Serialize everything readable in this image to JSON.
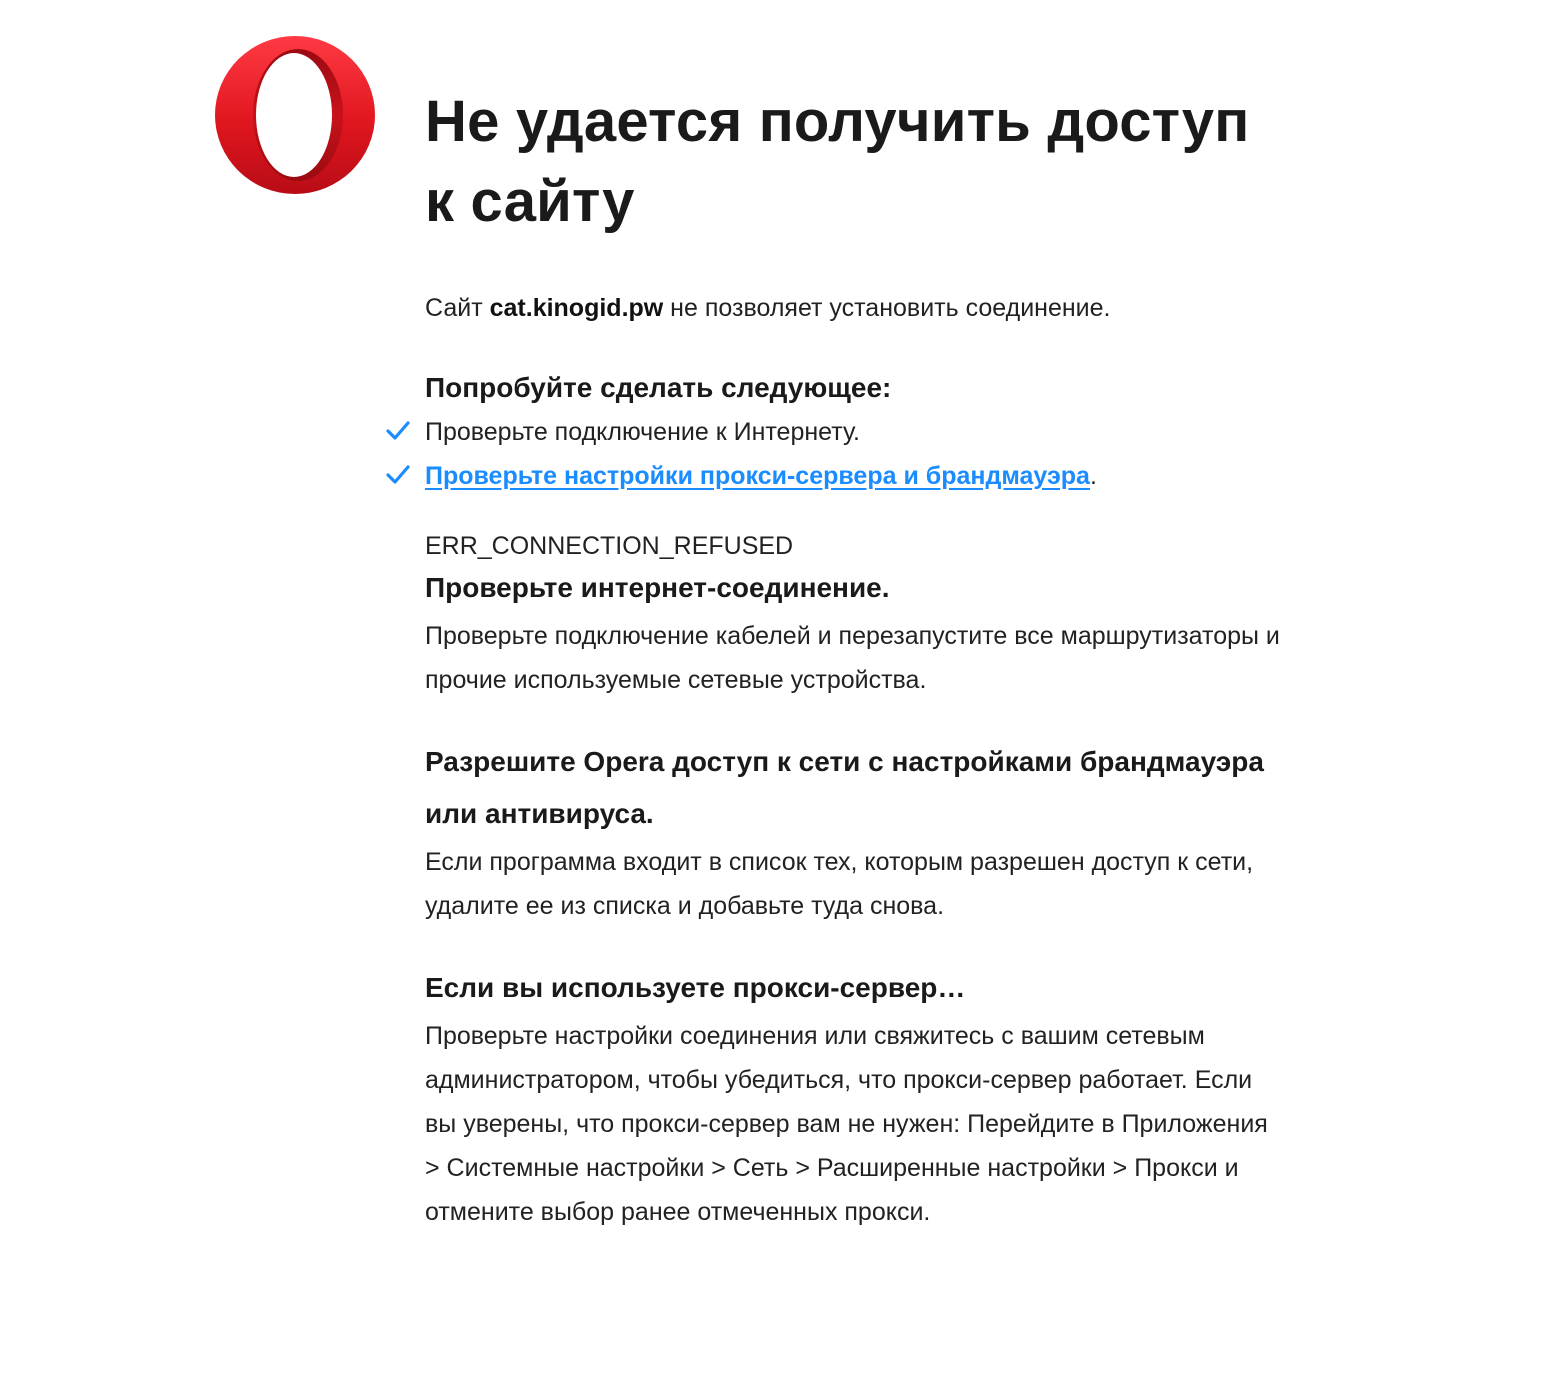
{
  "page": {
    "heading": "Не удается получить доступ к сайту",
    "intro_prefix": "Сайт ",
    "site_host": "cat.kinogid.pw",
    "intro_suffix": " не позволяет установить соединение.",
    "try_heading": "Попробуйте сделать следующее:",
    "suggestions": [
      {
        "text": "Проверьте подключение к Интернету.",
        "icon": "check-icon"
      },
      {
        "link_text": "Проверьте настройки прокси-сервера и брандмауэра",
        "after": ".",
        "icon": "check-icon"
      }
    ],
    "error_code": "ERR_CONNECTION_REFUSED",
    "sections": [
      {
        "title": "Проверьте интернет-соединение.",
        "body": "Проверьте подключение кабелей и перезапустите все маршрутизаторы и прочие используемые сетевые устройства."
      },
      {
        "title": "Разрешите Opera доступ к сети с настройками брандмауэра или антивируса.",
        "body": "Если программа входит в список тех, которым разрешен доступ к сети, удалите ее из списка и добавьте туда снова."
      },
      {
        "title": "Если вы используете прокси-сервер…",
        "body": "Проверьте настройки соединения или свяжитесь с вашим сетевым администратором, чтобы убедиться, что прокси-сервер работает. Если вы уверены, что прокси-сервер вам не нужен: Перейдите в Приложения > Системные настройки > Сеть > Расширенные настройки > Прокси и отмените выбор ранее отмеченных прокси."
      }
    ]
  },
  "logo": {
    "icon": "opera-logo-icon"
  },
  "colors": {
    "accent_link": "#1a8cff",
    "check": "#1a8cff",
    "logo_red": "#e0161e",
    "text": "#1e1e1e"
  }
}
